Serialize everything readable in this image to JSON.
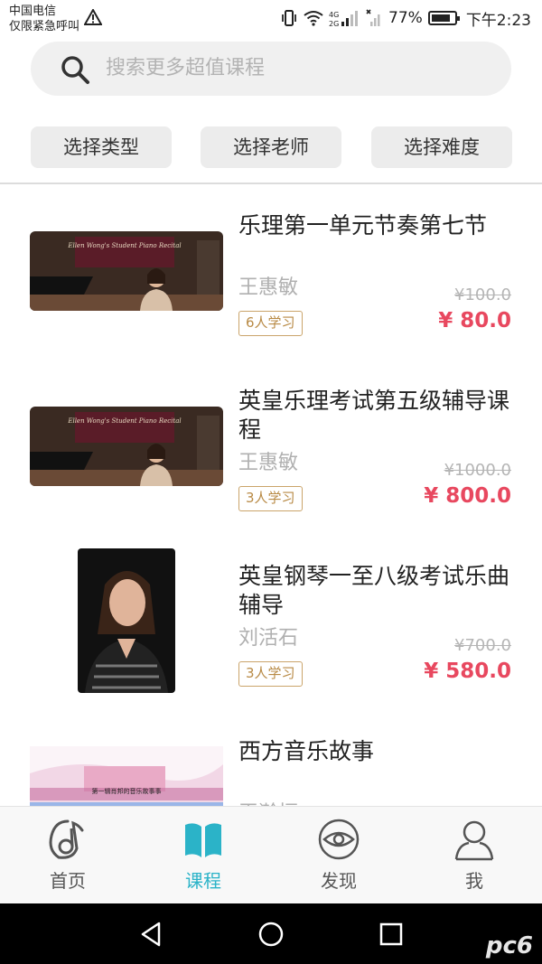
{
  "status": {
    "carrier_line1": "中国电信",
    "carrier_line2": "仅限紧急呼叫",
    "battery": "77%",
    "time": "下午2:23",
    "network": "4G"
  },
  "search": {
    "placeholder": "搜索更多超值课程"
  },
  "filters": [
    {
      "label": "选择类型"
    },
    {
      "label": "选择老师"
    },
    {
      "label": "选择难度"
    }
  ],
  "courses": [
    {
      "title": "乐理第一单元节奏第七节",
      "teacher": "王惠敏",
      "learners": "6人学习",
      "old_price": "¥100.0",
      "price": "¥ 80.0",
      "thumb_caption": "Ellen Wong's Student Piano Recital"
    },
    {
      "title": "英皇乐理考试第五级辅导课程",
      "teacher": "王惠敏",
      "learners": "3人学习",
      "old_price": "¥1000.0",
      "price": "¥ 800.0",
      "thumb_caption": "Ellen Wong's Student Piano Recital"
    },
    {
      "title": "英皇钢琴一至八级考试乐曲辅导",
      "teacher": "刘活石",
      "learners": "3人学习",
      "old_price": "¥700.0",
      "price": "¥ 580.0"
    },
    {
      "title": "西方音乐故事",
      "teacher": "王瀚恒",
      "thumb_caption": "第一辑肖邦的音乐故事事"
    }
  ],
  "tabs": [
    {
      "label": "首页",
      "icon": "music-note-icon"
    },
    {
      "label": "课程",
      "icon": "book-icon"
    },
    {
      "label": "发现",
      "icon": "eye-icon"
    },
    {
      "label": "我",
      "icon": "user-icon"
    }
  ],
  "active_tab": "课程",
  "colors": {
    "accent": "#2bb3c8",
    "price": "#e8485f",
    "badge": "#caa46a"
  },
  "watermark": "pc6"
}
